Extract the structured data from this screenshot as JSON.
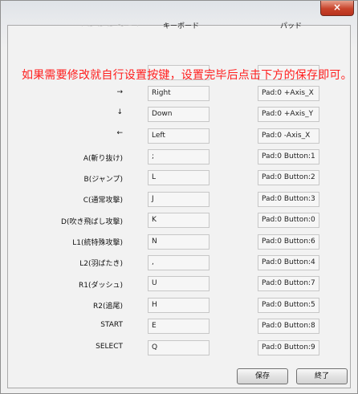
{
  "window": {
    "close_label": "×"
  },
  "header": {
    "faded_text": "· ~ ~ ~ ～ ｰ ･",
    "keyboard": "キーボード",
    "pad": "パッド"
  },
  "overlay_text": "如果需要修改就自行设置按键，设置完毕后点击下方的保存即可。",
  "rows": [
    {
      "label": "→",
      "kb": "Right",
      "pad": "Pad:0 +Axis_X"
    },
    {
      "label": "↓",
      "kb": "Down",
      "pad": "Pad:0 +Axis_Y"
    },
    {
      "label": "←",
      "kb": "Left",
      "pad": "Pad:0 -Axis_X"
    },
    {
      "label": "A(斬り抜け)",
      "kb": ";",
      "pad": "Pad:0 Button:1"
    },
    {
      "label": "B(ジャンプ)",
      "kb": "L",
      "pad": "Pad:0 Button:2"
    },
    {
      "label": "C(通常攻撃)",
      "kb": "J",
      "pad": "Pad:0 Button:3"
    },
    {
      "label": "D(吹き飛ばし攻撃)",
      "kb": "K",
      "pad": "Pad:0 Button:0"
    },
    {
      "label": "L1(統特殊攻撃)",
      "kb": "N",
      "pad": "Pad:0 Button:6"
    },
    {
      "label": "L2(羽ばたき)",
      "kb": ",",
      "pad": "Pad:0 Button:4"
    },
    {
      "label": "R1(ダッシュ)",
      "kb": "U",
      "pad": "Pad:0 Button:7"
    },
    {
      "label": "R2(追尾)",
      "kb": "H",
      "pad": "Pad:0 Button:5"
    },
    {
      "label": "START",
      "kb": "E",
      "pad": "Pad:0 Button:8"
    },
    {
      "label": "SELECT",
      "kb": "Q",
      "pad": "Pad:0 Button:9"
    }
  ],
  "buttons": {
    "save": "保存",
    "end": "終了"
  }
}
